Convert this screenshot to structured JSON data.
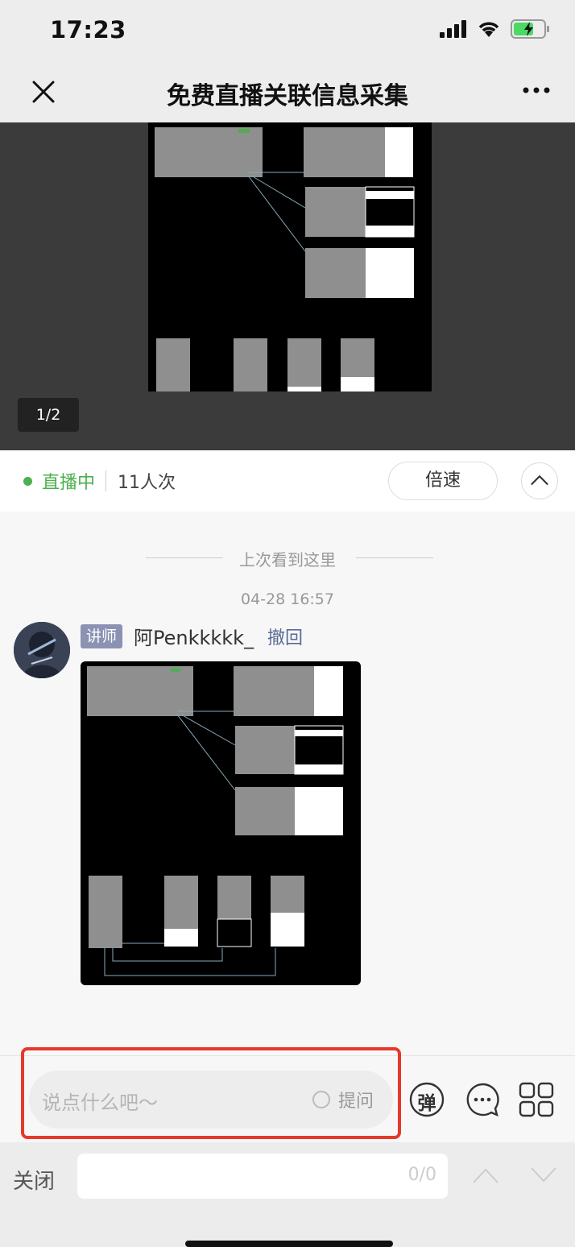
{
  "status": {
    "time": "17:23"
  },
  "nav": {
    "title": "免费直播关联信息采集"
  },
  "media": {
    "pager": "1/2"
  },
  "live": {
    "status": "直播中",
    "viewers": "11人次",
    "speed_label": "倍速"
  },
  "chat": {
    "last_seen": "上次看到这里",
    "timestamp": "04-28 16:57",
    "message": {
      "role_badge": "讲师",
      "username": "阿Penkkkkk_",
      "action": "撤回"
    }
  },
  "input": {
    "placeholder": "说点什么吧～",
    "ask_label": "提问",
    "danmaku_label": "弹"
  },
  "find": {
    "close_label": "关闭",
    "count": "0/0"
  },
  "colors": {
    "live_green": "#4bb04f",
    "highlight_red": "#e6392a",
    "link_blue": "#576b95",
    "badge": "#8b92b3"
  },
  "icons": [
    "close-icon",
    "more-icon",
    "signal-icon",
    "wifi-icon",
    "battery-icon",
    "chevron-up-icon",
    "comment-icon",
    "grid-icon",
    "chevron-down-icon"
  ]
}
